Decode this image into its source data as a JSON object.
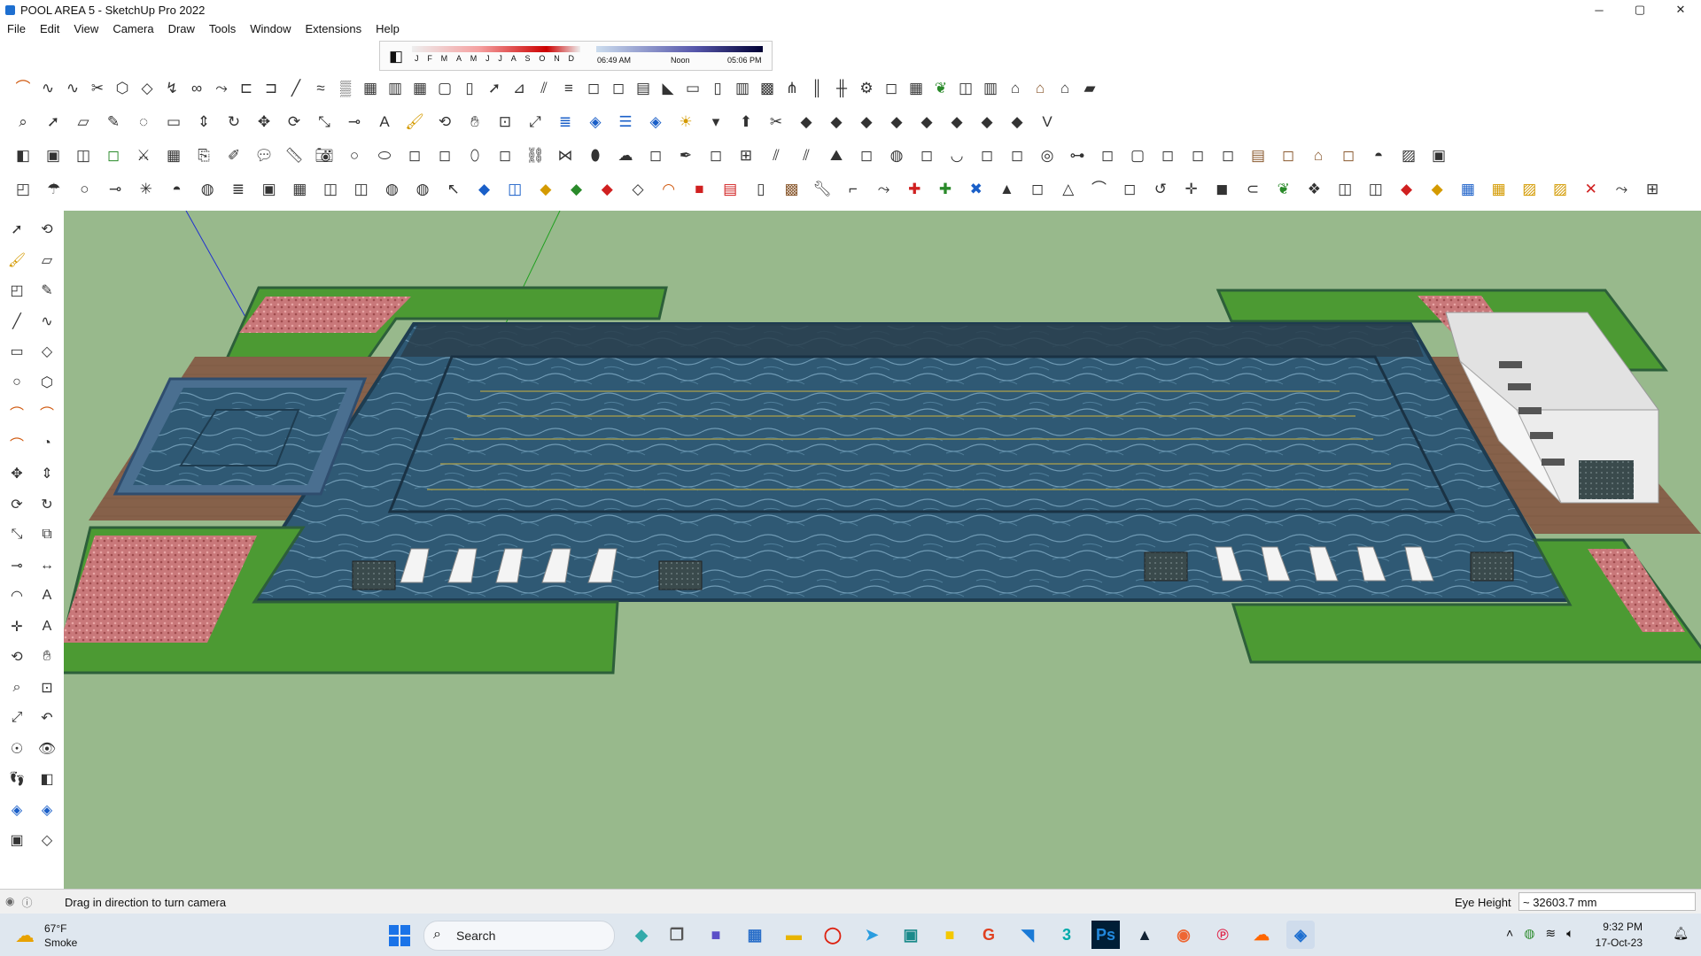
{
  "window": {
    "title": "POOL AREA 5 - SketchUp Pro 2022",
    "controls": {
      "minimize": "─",
      "maximize": "▢",
      "close": "✕"
    }
  },
  "menu": [
    "File",
    "Edit",
    "View",
    "Camera",
    "Draw",
    "Tools",
    "Window",
    "Extensions",
    "Help"
  ],
  "shadow": {
    "months": [
      "J",
      "F",
      "M",
      "A",
      "M",
      "J",
      "J",
      "A",
      "S",
      "O",
      "N",
      "D"
    ],
    "time_start": "06:49 AM",
    "time_mid": "Noon",
    "time_end": "05:06 PM"
  },
  "status": {
    "message": "Drag in direction to turn camera",
    "measure_label": "Eye Height",
    "measure_value": "~ 32603.7 mm"
  },
  "taskbar": {
    "weather_temp": "67°F",
    "weather_condition": "Smoke",
    "search_placeholder": "Search",
    "time": "9:32 PM",
    "date": "17-Oct-23"
  },
  "colors": {
    "background_ground": "#98b98c",
    "grass": "#4c9a33",
    "water": "#2e5670",
    "deck": "#86614a",
    "flowerbed": "#c77b7b"
  },
  "icons": {
    "row1": [
      "arc-icon",
      "bezier-icon",
      "curve-icon",
      "cut-icon",
      "shape-icon",
      "loft-icon",
      "bend-icon",
      "knot-icon",
      "sweep-icon",
      "rail-icon",
      "connect-icon",
      "line-icon",
      "soften-icon",
      "cloth-icon",
      "skin-icon",
      "column-icon",
      "grid-icon",
      "frame-icon",
      "wall-icon",
      "arrow-icon",
      "stair-icon",
      "split-icon",
      "lines-icon",
      "lines2-icon",
      "lines3-icon",
      "hatch-icon",
      "ramp-icon",
      "seat-icon",
      "door-icon",
      "stripes-icon",
      "pattern-icon",
      "comb-icon",
      "bars-icon",
      "fence-icon",
      "gear-icon",
      "gear2-icon",
      "mesh-icon",
      "leaf-icon",
      "cube-icon",
      "panel-icon",
      "house-icon",
      "roof-icon",
      "house-outline-icon",
      "shed-icon"
    ],
    "row2": [
      "zoom-icon",
      "select-icon",
      "eraser-icon",
      "pencil-icon",
      "lasso-icon",
      "rectangle-icon",
      "push-pull-icon",
      "follow-me-icon",
      "move-icon",
      "rotate-icon",
      "scale-icon",
      "tape-icon",
      "text-icon",
      "paint-icon",
      "orbit-icon",
      "pan-icon",
      "zoom-window-icon",
      "zoom-extents-icon",
      "layers-icon",
      "sandbox-icon",
      "stack-icon",
      "sandbox-2-icon",
      "sun-icon",
      "dropdown-icon",
      "extrude-icon",
      "cut-plane-icon",
      "plane-x-icon",
      "plane-y-icon",
      "plane-z-icon",
      "plane-a-icon",
      "plane-b-icon",
      "plane-c-icon",
      "plane-d-icon",
      "plane-e-icon",
      "vray-icon"
    ],
    "row3": [
      "section-icon",
      "box-icon",
      "cube-icon",
      "grass-icon",
      "knife-icon",
      "grid-icon",
      "copy-icon",
      "edit-icon",
      "comment-icon",
      "ruler-icon",
      "camera-icon",
      "circle-icon",
      "ellipse-icon",
      "ellipse2-icon",
      "ellipse3-icon",
      "oval-icon",
      "oval2-icon",
      "link-icon",
      "join-icon",
      "blob-icon",
      "cloud-icon",
      "cloud2-icon",
      "pen-icon",
      "pen2-icon",
      "split-box-icon",
      "split-box2-icon",
      "split-box3-icon",
      "terrain-icon",
      "terrain2-icon",
      "sphere-icon",
      "sphere2-icon",
      "cup-icon",
      "cup2-icon",
      "cup3-icon",
      "ring-icon",
      "slider-icon",
      "slider2-icon",
      "window-icon",
      "window2-icon",
      "window3-icon",
      "window4-icon",
      "brick-icon",
      "brick2-icon",
      "roof-icon",
      "roof2-icon",
      "pot-icon",
      "tile-icon",
      "stamp-icon"
    ],
    "row4": [
      "component-icon",
      "umbrella-icon",
      "circle-icon",
      "tape-measure-icon",
      "star-icon",
      "dome-icon",
      "sphere-icon",
      "layer-icon",
      "group-icon",
      "grid-icon",
      "cube-view-icon",
      "cube-view2-icon",
      "sphere-view-icon",
      "sphere-view2-icon",
      "cursor-icon",
      "cube-blue-icon",
      "cube-blue2-icon",
      "cube-yellow-icon",
      "cube-green-icon",
      "cube-red-icon",
      "cube-white-icon",
      "orange-arc-icon",
      "red-box-icon",
      "red-table-icon",
      "page-icon",
      "brown-box-icon",
      "wrench-icon",
      "pipe-icon",
      "path-icon",
      "red-plus-icon",
      "green-plus-icon",
      "blue-cross-icon",
      "cone-icon",
      "cone2-icon",
      "triangle-icon",
      "hook-icon",
      "hook2-icon",
      "loop-icon",
      "cross-icon",
      "bucket-icon",
      "magnet-icon",
      "tree-icon",
      "cube-multi-icon",
      "cube-multi2-icon",
      "cube-multi3-icon",
      "red-cube-icon",
      "gold-cube-icon",
      "panel-blue-icon",
      "tile-gold-icon",
      "tile-gold2-icon",
      "tile-gold3-icon",
      "red-x-icon",
      "path-curve-icon",
      "grid-select-icon"
    ],
    "left": [
      [
        "select-icon",
        "orbit-icon"
      ],
      [
        "paint-icon",
        "eraser-icon"
      ],
      [
        "component-icon",
        "pencil-icon"
      ],
      [
        "line-icon",
        "freehand-icon"
      ],
      [
        "rectangle-icon",
        "rotated-rectangle-icon"
      ],
      [
        "circle-icon",
        "polygon-icon"
      ],
      [
        "arc-icon",
        "arc2-icon"
      ],
      [
        "arc3-icon",
        "pie-icon"
      ],
      [
        "move-icon",
        "push-pull-icon"
      ],
      [
        "rotate-icon",
        "follow-me-icon"
      ],
      [
        "scale-icon",
        "offset-icon"
      ],
      [
        "tape-icon",
        "dimension-icon"
      ],
      [
        "protractor-icon",
        "text-icon"
      ],
      [
        "axes-icon",
        "3d-text-icon"
      ],
      [
        "orbit-icon",
        "pan-icon"
      ],
      [
        "zoom-icon",
        "zoom-window-icon"
      ],
      [
        "zoom-extents-icon",
        "previous-icon"
      ],
      [
        "position-camera-icon",
        "look-around-icon"
      ],
      [
        "walk-icon",
        "section-plane-icon"
      ],
      [
        "sandbox-icon",
        "sandbox2-icon"
      ],
      [
        "stamp-icon",
        "drape-icon"
      ]
    ]
  }
}
